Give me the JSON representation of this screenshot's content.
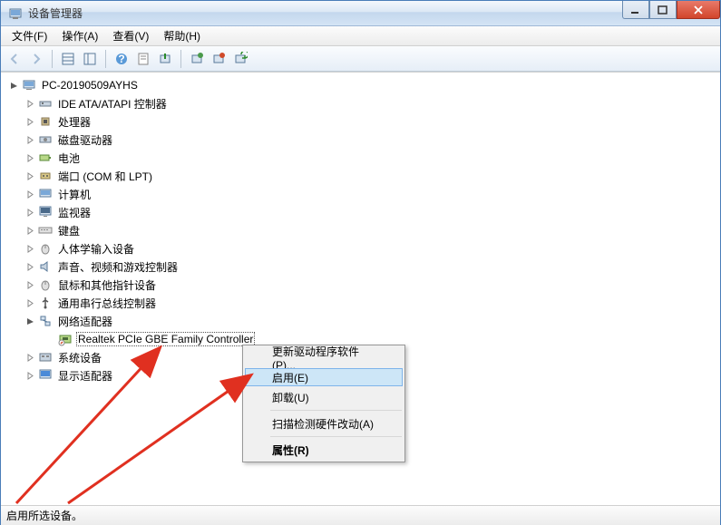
{
  "window": {
    "title": "设备管理器"
  },
  "menu": {
    "file": "文件(F)",
    "action": "操作(A)",
    "view": "查看(V)",
    "help": "帮助(H)"
  },
  "tree": {
    "root": "PC-20190509AYHS",
    "items": [
      "IDE ATA/ATAPI 控制器",
      "处理器",
      "磁盘驱动器",
      "电池",
      "端口 (COM 和 LPT)",
      "计算机",
      "监视器",
      "键盘",
      "人体学输入设备",
      "声音、视频和游戏控制器",
      "鼠标和其他指针设备",
      "通用串行总线控制器",
      "网络适配器",
      "系统设备",
      "显示适配器"
    ],
    "network_device": "Realtek PCIe GBE Family Controller"
  },
  "context_menu": {
    "update": "更新驱动程序软件(P)...",
    "enable": "启用(E)",
    "uninstall": "卸载(U)",
    "scan": "扫描检测硬件改动(A)",
    "properties": "属性(R)"
  },
  "status": "启用所选设备。"
}
